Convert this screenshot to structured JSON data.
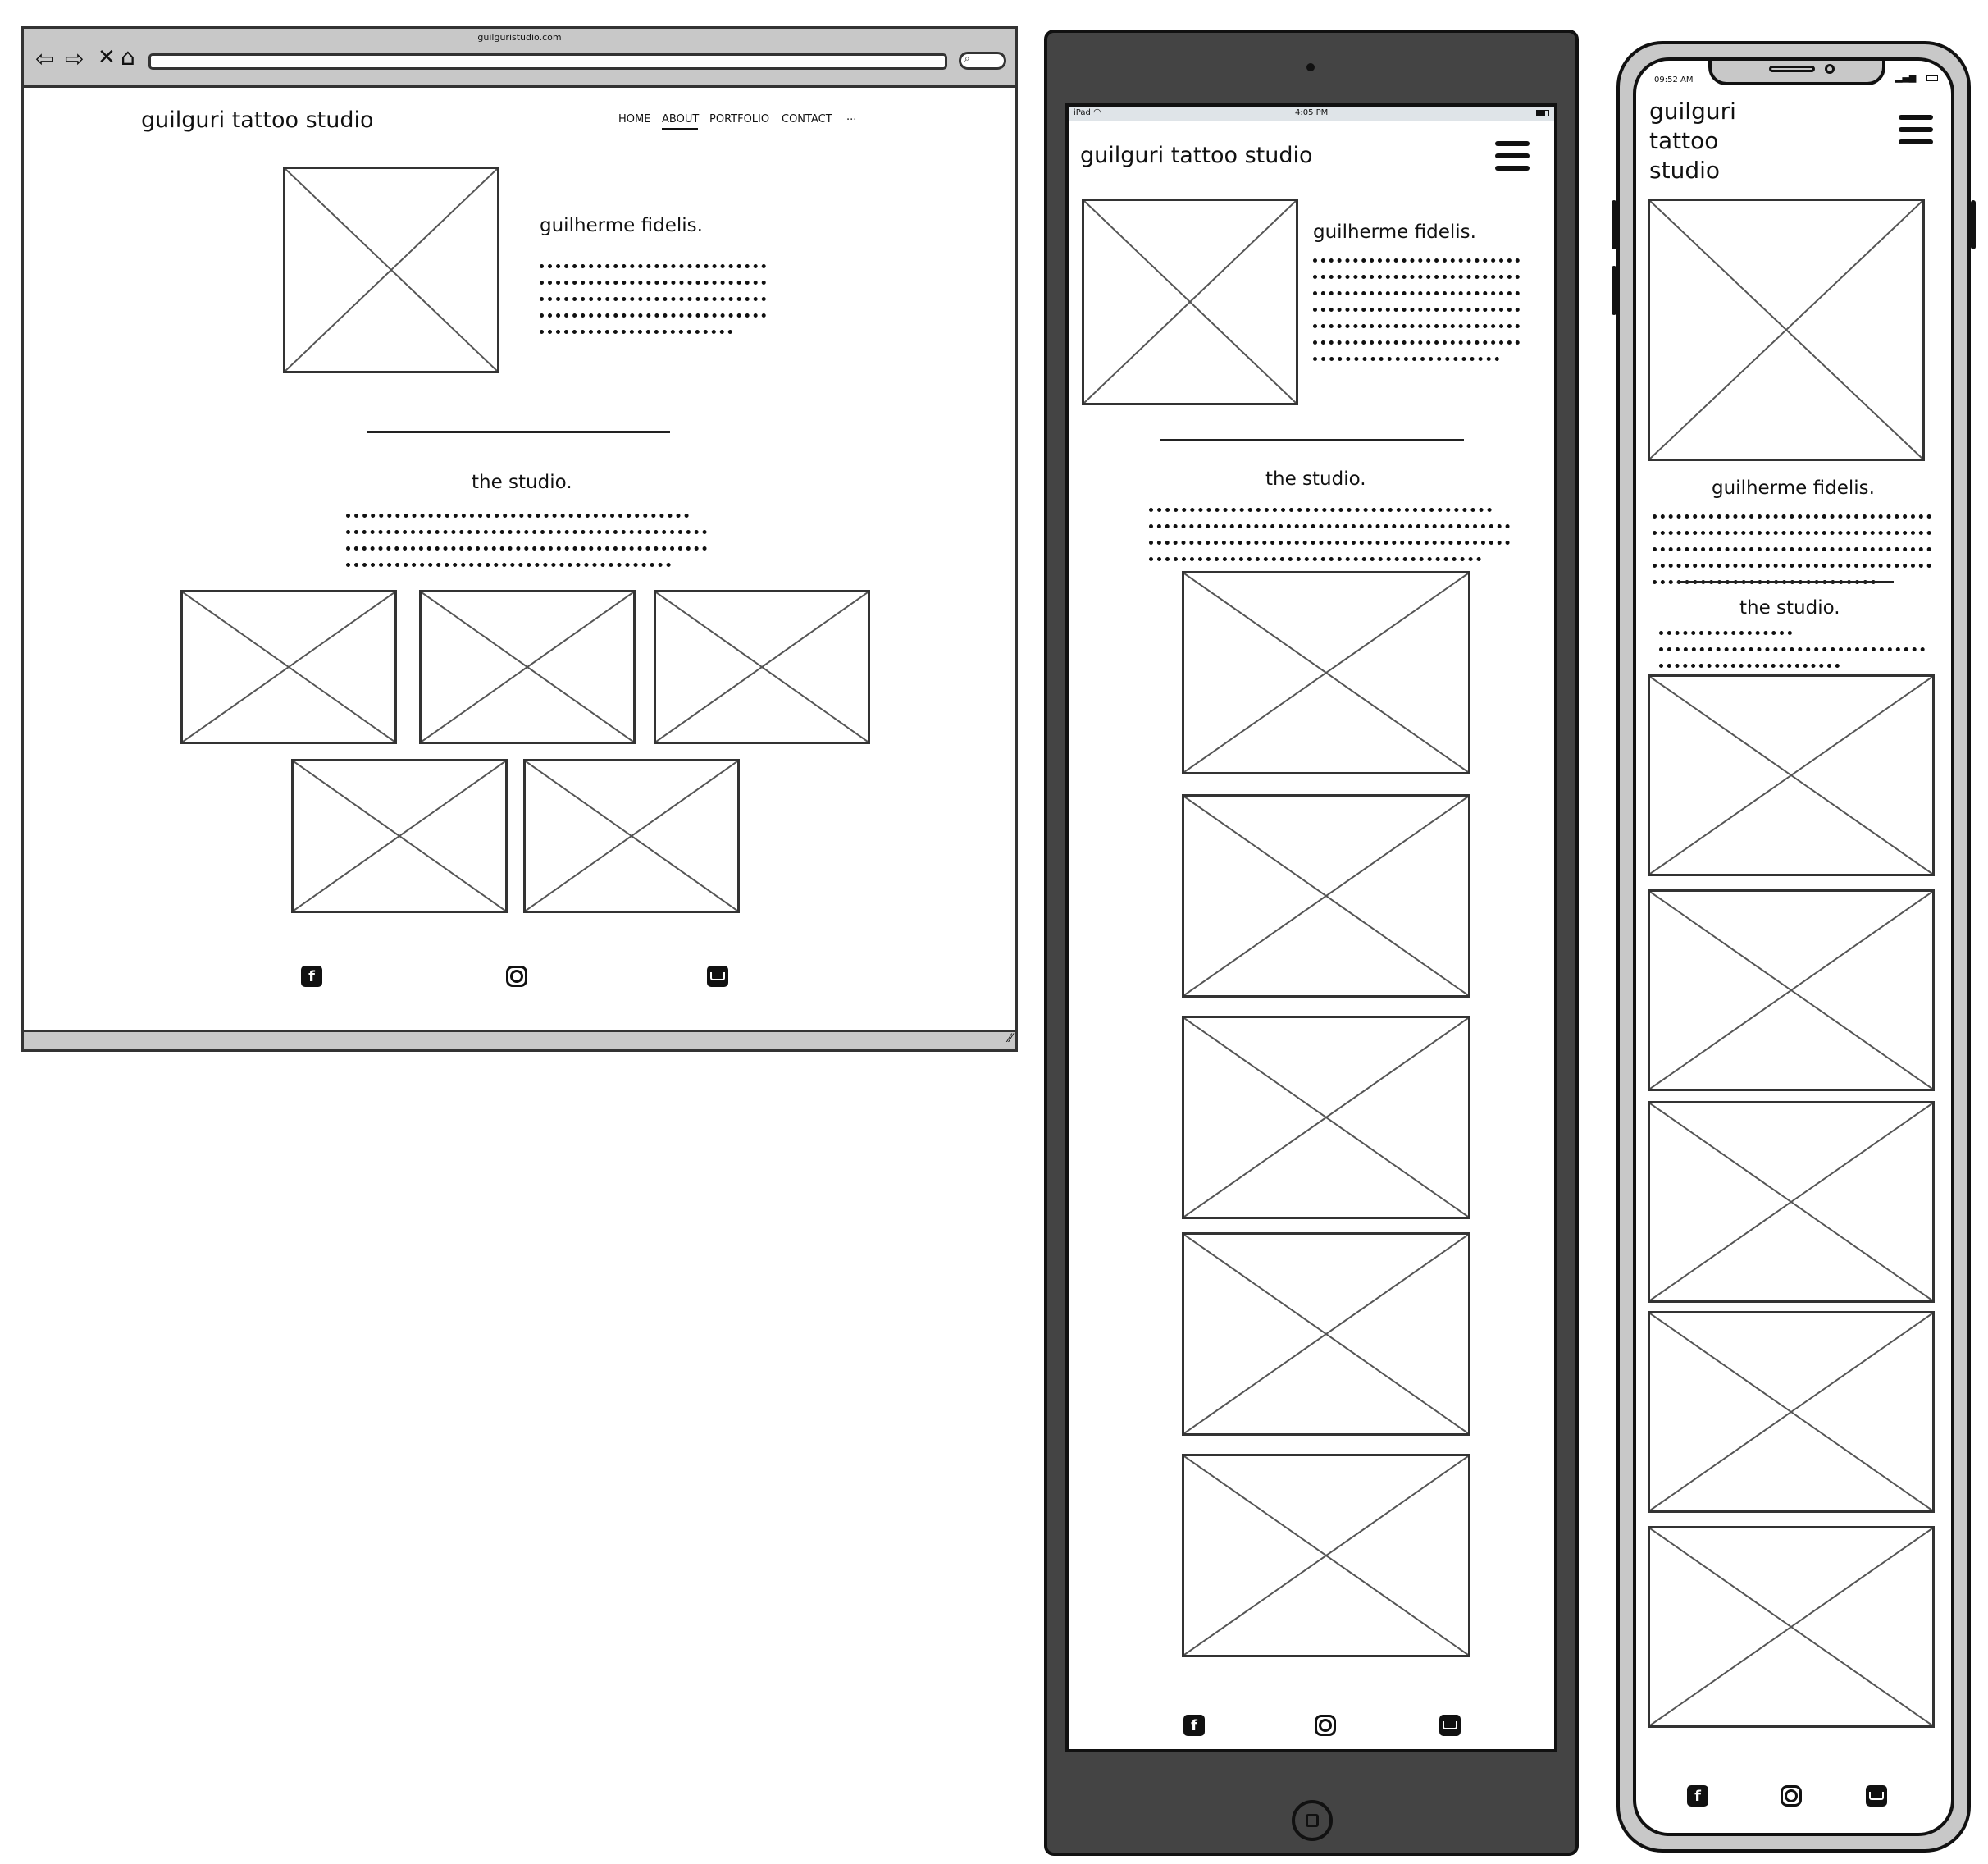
{
  "desktop": {
    "url": "guilguristudio.com",
    "site_title": "guilguri tattoo studio",
    "nav": [
      {
        "label": "HOME"
      },
      {
        "label": "ABOUT"
      },
      {
        "label": "PORTFOLIO"
      },
      {
        "label": "CONTACT"
      },
      {
        "label": "..."
      }
    ],
    "about_heading": "guilherme fidelis.",
    "studio_heading": "the studio."
  },
  "tablet": {
    "status_device": "iPad",
    "status_time": "4:05 PM",
    "site_title": "guilguri tattoo studio",
    "about_heading": "guilherme fidelis.",
    "studio_heading": "the studio."
  },
  "phone": {
    "status_time": "09:52 AM",
    "site_title_line1": "guilguri",
    "site_title_line2": "tattoo",
    "site_title_line3": "studio",
    "about_heading": "guilherme fidelis.",
    "studio_heading": "the studio."
  },
  "icons": {
    "facebook": "f",
    "instagram": "",
    "email": ""
  }
}
